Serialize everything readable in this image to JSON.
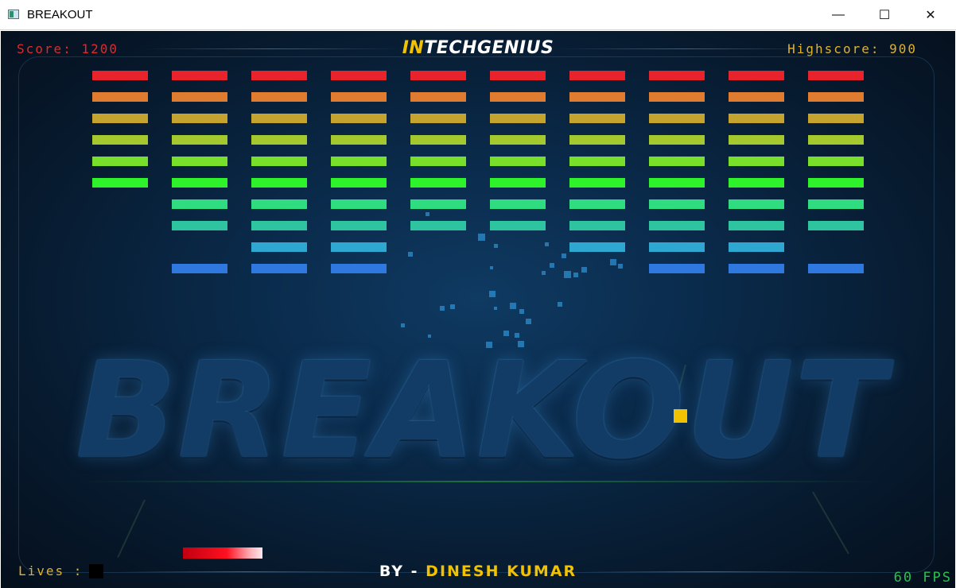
{
  "window": {
    "title": "BREAKOUT",
    "minimize": "—",
    "maximize": "☐",
    "close": "✕"
  },
  "hud": {
    "score_text": "Score: 1200",
    "highscore_text": "Highscore: 900",
    "lives_label": "Lives :",
    "fps_text": "60 FPS"
  },
  "logo": {
    "prefix": "IN",
    "rest": "TECHGENIUS"
  },
  "byline": {
    "prefix": "BY - ",
    "name": "DINESH KUMAR"
  },
  "background_title": "BREAKOUT",
  "colors": {
    "row1": "#e8232b",
    "row2": "#e07c30",
    "row3": "#c4a42e",
    "row4": "#a3c92e",
    "row5": "#78e02a",
    "row6": "#2ef22a",
    "row7": "#30dc80",
    "row8": "#2ec4a0",
    "row9": "#2ea8d0",
    "row10": "#2e78e0",
    "ball": "#f2c200",
    "paddle": "#ff1020"
  },
  "bricks": {
    "columns": 10,
    "rows": [
      {
        "color": "#e8232b",
        "present": [
          1,
          1,
          1,
          1,
          1,
          1,
          1,
          1,
          1,
          1
        ]
      },
      {
        "color": "#e07c30",
        "present": [
          1,
          1,
          1,
          1,
          1,
          1,
          1,
          1,
          1,
          1
        ]
      },
      {
        "color": "#c4a42e",
        "present": [
          1,
          1,
          1,
          1,
          1,
          1,
          1,
          1,
          1,
          1
        ]
      },
      {
        "color": "#a3c92e",
        "present": [
          1,
          1,
          1,
          1,
          1,
          1,
          1,
          1,
          1,
          1
        ]
      },
      {
        "color": "#78e02a",
        "present": [
          1,
          1,
          1,
          1,
          1,
          1,
          1,
          1,
          1,
          1
        ]
      },
      {
        "color": "#2ef22a",
        "present": [
          1,
          1,
          1,
          1,
          1,
          1,
          1,
          1,
          1,
          1
        ]
      },
      {
        "color": "#30dc80",
        "present": [
          0,
          1,
          1,
          1,
          1,
          1,
          1,
          1,
          1,
          1
        ]
      },
      {
        "color": "#2ec4a0",
        "present": [
          0,
          1,
          1,
          1,
          1,
          1,
          1,
          1,
          1,
          1
        ]
      },
      {
        "color": "#2ea8d0",
        "present": [
          0,
          0,
          1,
          1,
          0,
          0,
          1,
          1,
          1,
          0
        ]
      },
      {
        "color": "#2e78e0",
        "present": [
          0,
          1,
          1,
          1,
          0,
          0,
          0,
          1,
          1,
          1
        ]
      }
    ]
  }
}
